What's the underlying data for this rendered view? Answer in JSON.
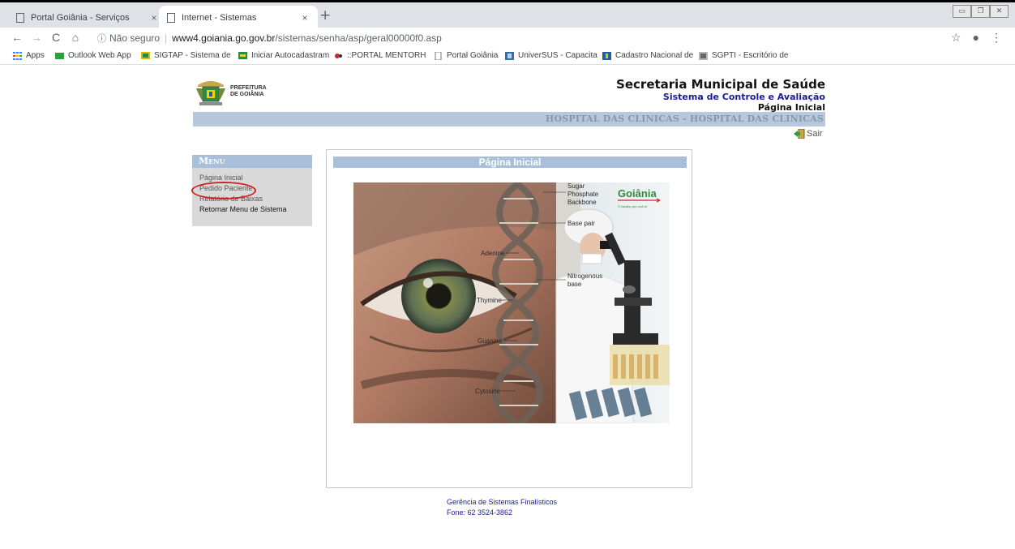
{
  "browser": {
    "tabs": [
      {
        "title": "Portal Goiânia - Serviços",
        "close": "×",
        "active": false
      },
      {
        "title": "Internet - Sistemas",
        "close": "×",
        "active": true
      }
    ],
    "new_tab": "+",
    "nav": {
      "back": "←",
      "forward": "→",
      "reload": "C",
      "home": "⌂"
    },
    "address": {
      "info": "ⓘ",
      "security": "Não seguro",
      "separator": "|",
      "host": "www4.goiania.go.gov.br",
      "path": "/sistemas/senha/asp/geral00000f0.asp"
    },
    "star": "☆",
    "profile": "●",
    "kebab": "⋮",
    "bookmarks": [
      {
        "label": "Apps",
        "color": "#4285f4"
      },
      {
        "label": "Outlook Web App",
        "color": "#2e9e3e"
      },
      {
        "label": "SIGTAP - Sistema de",
        "color": "#e0b900"
      },
      {
        "label": "Iniciar Autocadastram",
        "color": "#2e8b3e"
      },
      {
        "label": "::PORTAL MENTORH",
        "color": "#d32222"
      },
      {
        "label": "Portal Goiânia",
        "color": "#777777"
      },
      {
        "label": "UniverSUS - Capacita",
        "color": "#2f6fb5"
      },
      {
        "label": "Cadastro Nacional de",
        "color": "#1f5fa5"
      },
      {
        "label": "SGPTI - Escritório de",
        "color": "#888888"
      }
    ]
  },
  "page": {
    "logo_text_1": "PREFEITURA",
    "logo_text_2": "DE GOIÂNIA",
    "header_title": "Secretaria Municipal de Saúde",
    "header_subtitle": "Sistema de Controle e Avaliação",
    "header_page": "Página Inicial",
    "unit_banner": "HOSPITAL DAS CLINICAS - HOSPITAL DAS CLINICAS",
    "logout_label": "Sair",
    "menu": {
      "title": "Menu",
      "items": [
        {
          "label": "Página Inicial"
        },
        {
          "label": "Pedido Paciente"
        },
        {
          "label": "Relatório de Baixas"
        },
        {
          "label": "Retornar Menu de Sistema"
        }
      ]
    },
    "content_title": "Página Inicial",
    "hero_labels": {
      "sugar": "Sugar",
      "phosphate": "Phosphate",
      "backbone": "Backbone",
      "base_pair": "Base pair",
      "adenine": "Adenine",
      "nitrogenous": "Nitrogenous",
      "base": "base",
      "thymine": "Thymine",
      "guanine": "Guanine",
      "cytosine": "Cytosine",
      "brand": "Goiânia",
      "brand_tagline": "O trabalho que você vê"
    },
    "footer_line_1": "Gerência de Sistemas Finalísticos",
    "footer_line_2": "Fone: 62 3524-3862"
  }
}
